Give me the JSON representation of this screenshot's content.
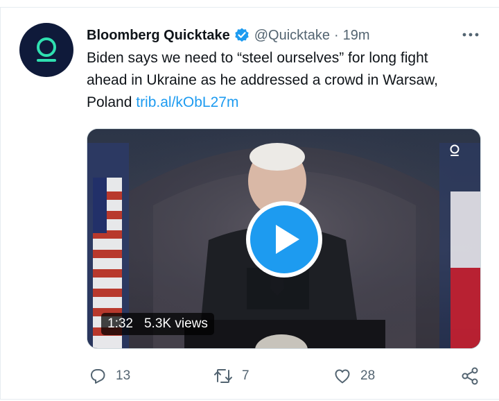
{
  "account": {
    "display_name": "Bloomberg Quicktake",
    "handle": "@Quicktake",
    "separator": "·",
    "time": "19m",
    "verified": true,
    "avatar_icon": "quicktake-q-logo-icon",
    "avatar_bg": "#0f1a3a",
    "avatar_accent": "#2fe0b0"
  },
  "tweet": {
    "text_lines": [
      "Biden says we need to “steel ourselves” for long fight",
      "ahead in Ukraine as he addressed a crowd in Warsaw,",
      "Poland "
    ],
    "link": "trib.al/kObL27m"
  },
  "media": {
    "duration": "1:32",
    "views": "5.3K views",
    "play_icon": "play-icon"
  },
  "actions": {
    "reply_count": "13",
    "retweet_count": "7",
    "like_count": "28"
  },
  "colors": {
    "accent": "#1d9bf0",
    "secondary_text": "#536471",
    "primary_text": "#0f1419"
  }
}
